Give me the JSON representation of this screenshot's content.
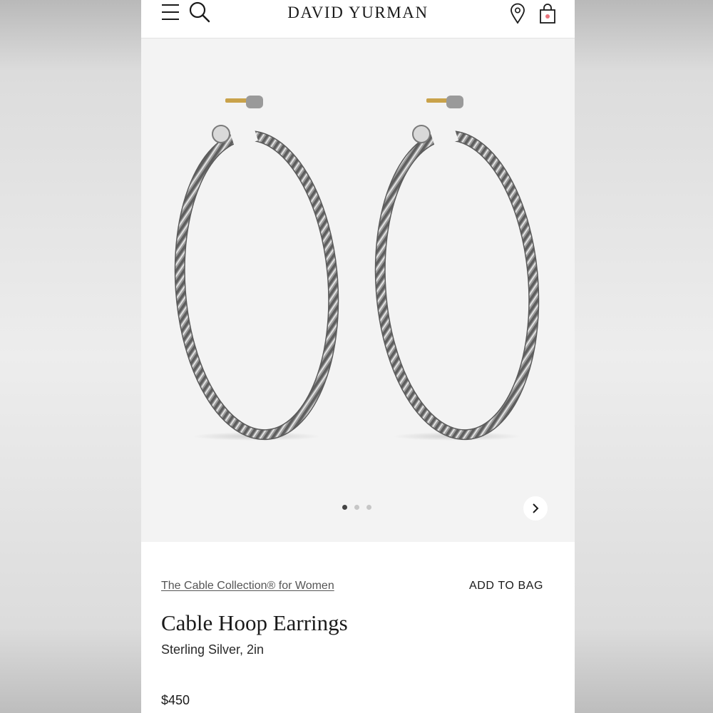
{
  "header": {
    "brand": "DAVID YURMAN",
    "icons": [
      "menu-icon",
      "search-icon",
      "location-icon",
      "shopping-bag-icon"
    ],
    "bag_badge_color": "#e8747c"
  },
  "gallery": {
    "image_count": 3,
    "active_index": 0,
    "metal_color": "#8e8e8e",
    "post_color": "#c9a24a"
  },
  "product": {
    "collection_link": "The Cable Collection® for Women",
    "add_to_bag": "ADD TO BAG",
    "title": "Cable Hoop Earrings",
    "variant": "Sterling Silver, 2in",
    "price": "$450"
  }
}
